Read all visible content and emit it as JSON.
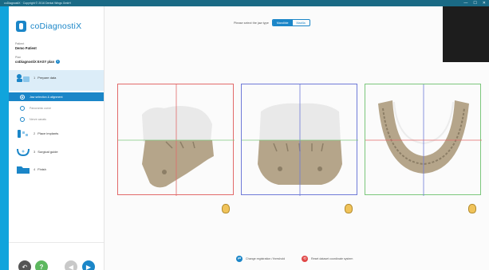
{
  "window": {
    "title": "coDiagnostiX · Copyright © 2016 Dental Wings GmbH",
    "minimize": "—",
    "maximize": "☐",
    "close": "✕"
  },
  "app": {
    "logo_text": "coDiagnostiX"
  },
  "patient": {
    "label": "Patient",
    "name": "Demo Patient"
  },
  "plan": {
    "label": "Plan",
    "name": "coDiagnostiX EASY plan",
    "info": "i"
  },
  "steps": [
    {
      "label": "Prepare data",
      "num": "1"
    },
    {
      "label": "Place implants",
      "num": "2"
    },
    {
      "label": "Surgical guide",
      "num": "3"
    },
    {
      "label": "Finish",
      "num": "4"
    }
  ],
  "substeps": [
    {
      "label": "Jaw selection & alignment"
    },
    {
      "label": "Panoramic curve"
    },
    {
      "label": "Nerve canals"
    }
  ],
  "toolbar": {
    "jaw_question": "Please select the jaw type",
    "options": [
      "Mandible",
      "Maxilla"
    ],
    "selected": "Mandible"
  },
  "footer": {
    "change_reg": "Change registration / threshold",
    "reset": "Reset dataset coordinate system"
  },
  "nav": {
    "undo": "↶",
    "help": "?",
    "prev": "◀",
    "next": "▶"
  },
  "colors": {
    "accent": "#1b86c8",
    "frame_red": "#e26a6a",
    "frame_blue": "#6f7ad8",
    "frame_green": "#7cc77c",
    "help_green": "#5db85f"
  }
}
